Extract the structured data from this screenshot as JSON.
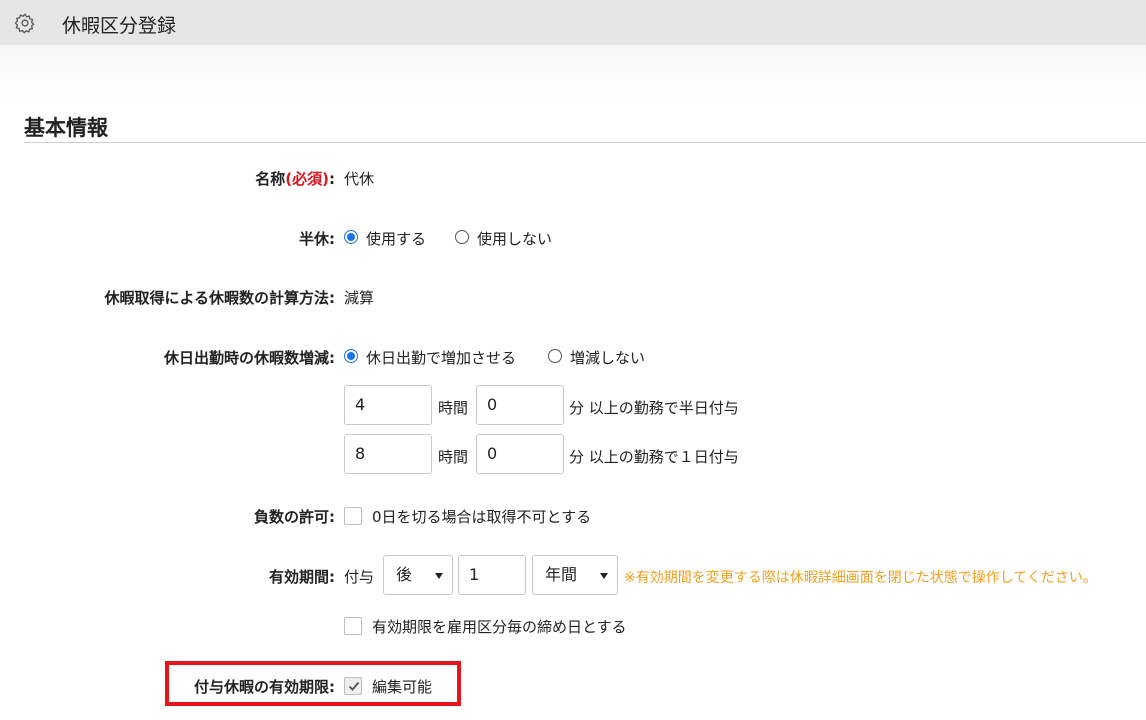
{
  "header": {
    "title": "休暇区分登録",
    "icon": "gear-icon"
  },
  "section": {
    "title": "基本情報"
  },
  "name_row": {
    "label": "名称",
    "required": "(必須)",
    "colon": ":",
    "value": "代休"
  },
  "half_day": {
    "label": "半休:",
    "options": [
      {
        "label": "使用する",
        "selected": true
      },
      {
        "label": "使用しない",
        "selected": false
      }
    ]
  },
  "calc_method": {
    "label": "休暇取得による休暇数の計算方法:",
    "value": "減算"
  },
  "holiday_work": {
    "label": "休日出勤時の休暇数増減:",
    "options": [
      {
        "label": "休日出勤で増加させる",
        "selected": true
      },
      {
        "label": "増減しない",
        "selected": false
      }
    ],
    "rules": [
      {
        "hours": "4",
        "hours_unit": "時間",
        "minutes": "0",
        "suffix": "分 以上の勤務で半日付与"
      },
      {
        "hours": "8",
        "hours_unit": "時間",
        "minutes": "0",
        "suffix": "分 以上の勤務で１日付与"
      }
    ]
  },
  "negative": {
    "label": "負数の許可:",
    "checkbox_label": "0日を切る場合は取得不可とする",
    "checked": false
  },
  "validity": {
    "label": "有効期間:",
    "prefix": "付与",
    "timing": "後",
    "amount": "1",
    "unit": "年間",
    "note": "※有効期間を変更する際は休暇詳細画面を閉じた状態で操作してください。",
    "closing_day_label": "有効期限を雇用区分毎の締め日とする",
    "closing_day_checked": false
  },
  "granted_validity": {
    "label": "付与休暇の有効期限:",
    "checkbox_label": "編集可能",
    "checked": true
  },
  "colors": {
    "accent": "#1a73e8",
    "required": "#d9141b",
    "warning": "#f0a020",
    "highlight": "#e8141b"
  }
}
